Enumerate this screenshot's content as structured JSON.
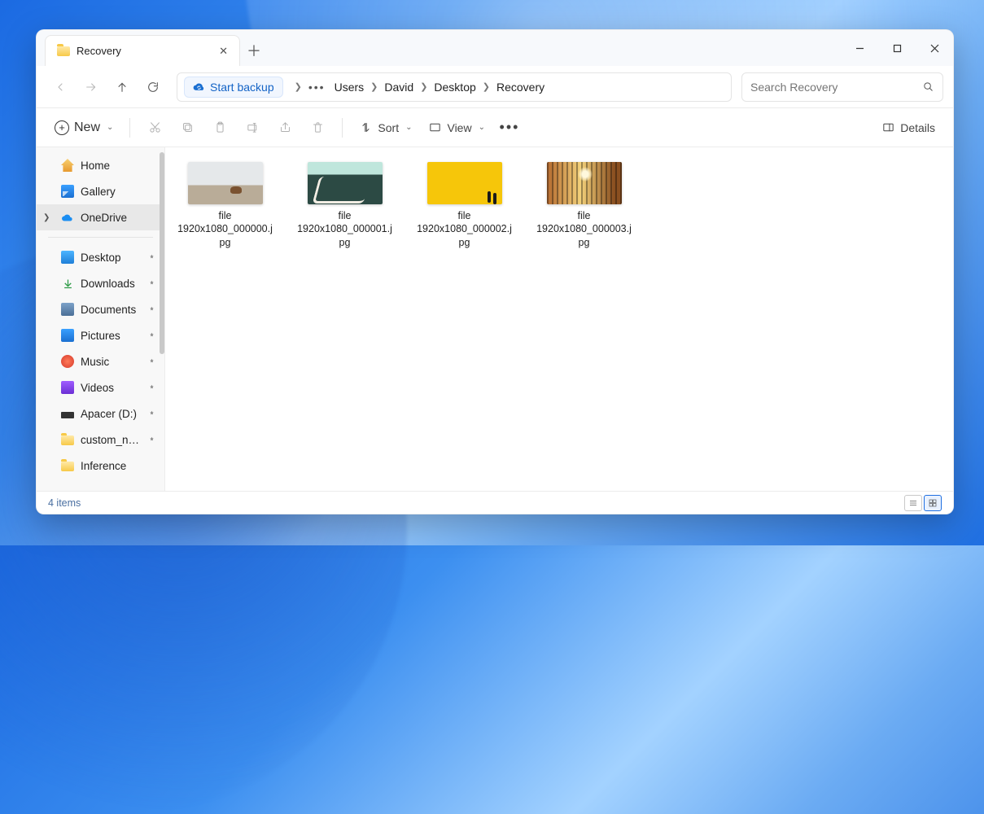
{
  "tab": {
    "title": "Recovery"
  },
  "breadcrumb": {
    "backup_label": "Start backup",
    "items": [
      "Users",
      "David",
      "Desktop",
      "Recovery"
    ]
  },
  "search": {
    "placeholder": "Search Recovery"
  },
  "toolbar": {
    "new_label": "New",
    "sort_label": "Sort",
    "view_label": "View",
    "details_label": "Details"
  },
  "sidebar": {
    "top": [
      {
        "label": "Home"
      },
      {
        "label": "Gallery"
      },
      {
        "label": "OneDrive"
      }
    ],
    "pinned": [
      {
        "label": "Desktop"
      },
      {
        "label": "Downloads"
      },
      {
        "label": "Documents"
      },
      {
        "label": "Pictures"
      },
      {
        "label": "Music"
      },
      {
        "label": "Videos"
      },
      {
        "label": "Apacer (D:)"
      },
      {
        "label": "custom_node"
      },
      {
        "label": "Inference"
      }
    ]
  },
  "files": [
    {
      "name": "file 1920x1080_000000.jpg"
    },
    {
      "name": "file 1920x1080_000001.jpg"
    },
    {
      "name": "file 1920x1080_000002.jpg"
    },
    {
      "name": "file 1920x1080_000003.jpg"
    }
  ],
  "status": {
    "count_text": "4 items"
  }
}
